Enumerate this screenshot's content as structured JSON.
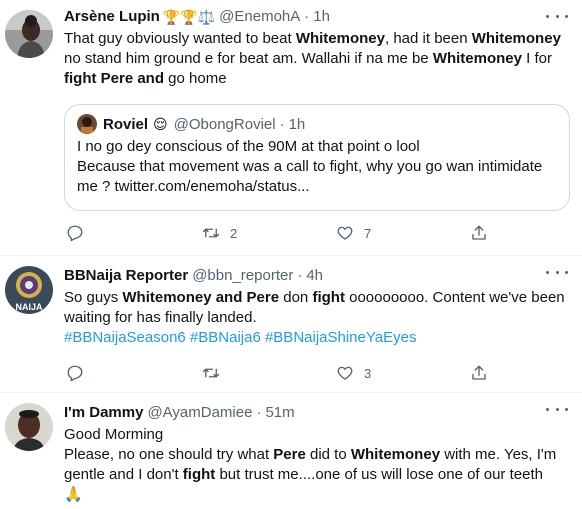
{
  "tweets": [
    {
      "name": "Arsène Lupin",
      "badges": "🏆🏆⚖️",
      "handle": "@EnemohA",
      "separator": "·",
      "time": "1h",
      "text_parts": [
        "That guy obviously wanted to beat ",
        "Whitemoney",
        ", had it been ",
        "Whitemoney",
        " no stand him ground e for beat am. Wallahi if na me be ",
        "Whitemoney",
        " I for ",
        "fight Pere and",
        " go home"
      ],
      "quote": {
        "name": "Roviel",
        "emoji": "😌",
        "handle": "@ObongRoviel",
        "separator": "·",
        "time": "1h",
        "text": "I no go dey conscious of the 90M at that point o lool\nBecause that movement was a call to fight, why you go wan intimidate me ? twitter.com/enemoha/status..."
      },
      "actions": {
        "reply": "",
        "retweet": "2",
        "like": "7"
      }
    },
    {
      "name": "BBNaija Reporter",
      "handle": "@bbn_reporter",
      "separator": "·",
      "time": "4h",
      "avatar_text": "NAIJA",
      "text_parts": [
        "So guys ",
        "Whitemoney and Pere",
        " don ",
        "fight",
        " ooooooooo. Content we've been waiting for has finally landed."
      ],
      "hashtags": "#BBNaijaSeason6 #BBNaija6 #BBNaijaShineYaEyes",
      "actions": {
        "reply": "",
        "retweet": "",
        "like": "3"
      }
    },
    {
      "name": "I'm Dammy",
      "handle": "@AyamDamiee",
      "separator": "·",
      "time": "51m",
      "text_line1": "Good Morming",
      "text_parts": [
        "Please, no one should try what ",
        "Pere",
        " did to ",
        "Whitemoney",
        " with me. Yes, I'm gentle and I don't ",
        "fight",
        " but trust me....one of us will lose one of our teeth"
      ],
      "emoji": "🙏"
    }
  ],
  "icons": [
    "reply-icon",
    "retweet-icon",
    "like-icon",
    "share-icon",
    "more-icon"
  ],
  "colors": {
    "text": "#0f1419",
    "secondary": "#536471",
    "link": "#1d9bf0",
    "border": "#eff3f4"
  }
}
